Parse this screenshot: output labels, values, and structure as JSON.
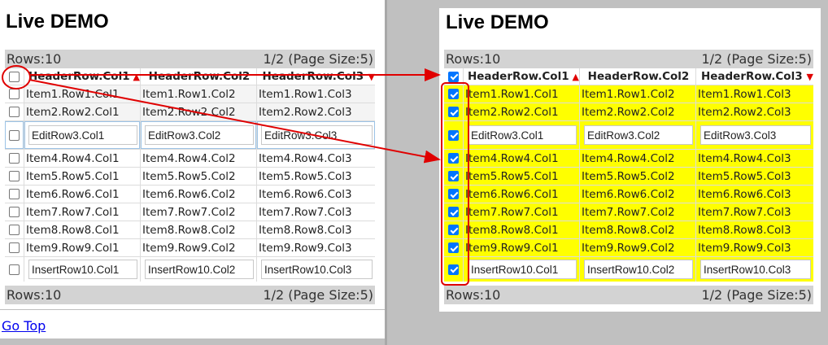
{
  "title": "Live DEMO",
  "rows_label": "Rows:10",
  "page_label": "1/2 (Page Size:5)",
  "go_top": "Go Top",
  "headers": [
    "HeaderRow.Col1",
    "HeaderRow.Col2",
    "HeaderRow.Col3"
  ],
  "sort": {
    "col1": "▲",
    "col3": "▼"
  },
  "rows": [
    {
      "type": "item",
      "cells": [
        "Item1.Row1.Col1",
        "Item1.Row1.Col2",
        "Item1.Row1.Col3"
      ]
    },
    {
      "type": "item",
      "cells": [
        "Item2.Row2.Col1",
        "Item2.Row2.Col2",
        "Item2.Row2.Col3"
      ]
    },
    {
      "type": "edit",
      "cells": [
        "EditRow3.Col1",
        "EditRow3.Col2",
        "EditRow3.Col3"
      ]
    },
    {
      "type": "item",
      "cells": [
        "Item4.Row4.Col1",
        "Item4.Row4.Col2",
        "Item4.Row4.Col3"
      ]
    },
    {
      "type": "item",
      "cells": [
        "Item5.Row5.Col1",
        "Item5.Row5.Col2",
        "Item5.Row5.Col3"
      ]
    },
    {
      "type": "item",
      "cells": [
        "Item6.Row6.Col1",
        "Item6.Row6.Col2",
        "Item6.Row6.Col3"
      ]
    },
    {
      "type": "item",
      "cells": [
        "Item7.Row7.Col1",
        "Item7.Row7.Col2",
        "Item7.Row7.Col3"
      ]
    },
    {
      "type": "item",
      "cells": [
        "Item8.Row8.Col1",
        "Item8.Row8.Col2",
        "Item8.Row8.Col3"
      ]
    },
    {
      "type": "item",
      "cells": [
        "Item9.Row9.Col1",
        "Item9.Row9.Col2",
        "Item9.Row9.Col3"
      ]
    },
    {
      "type": "insert",
      "cells": [
        "InsertRow10.Col1",
        "InsertRow10.Col2",
        "InsertRow10.Col3"
      ]
    }
  ],
  "colors": {
    "selected_row": "#ffff00",
    "annotation": "#e00000",
    "checkbox_on": "#0075ff"
  }
}
